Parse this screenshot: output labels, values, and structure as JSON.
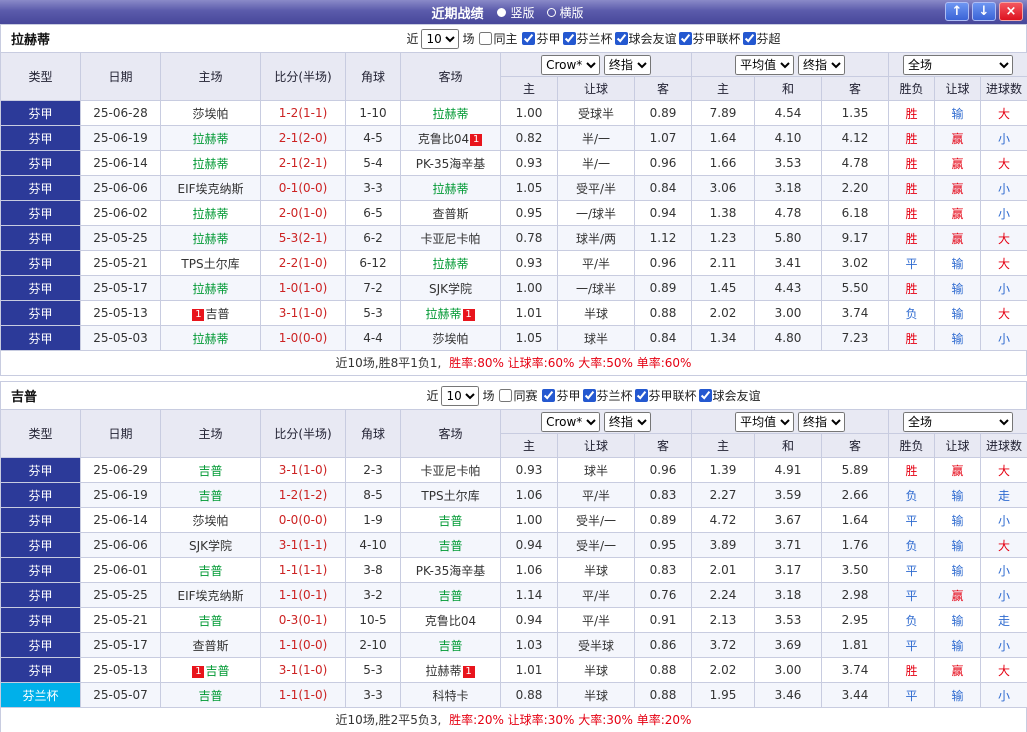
{
  "titlebar": {
    "title": "近期战绩",
    "radios": [
      {
        "label": "竖版",
        "selected": true
      },
      {
        "label": "横版",
        "selected": false
      }
    ],
    "up_icon": "↑",
    "down_icon": "↓",
    "close_icon": "×"
  },
  "filter_common": {
    "prefix": "近",
    "count": "10",
    "suffix": "场"
  },
  "table_header": {
    "main": [
      "类型",
      "日期",
      "主场",
      "比分(半场)",
      "角球",
      "客场"
    ],
    "group1": {
      "select_a": "Crow*",
      "select_b": "终指",
      "cols": [
        "主",
        "让球",
        "客"
      ]
    },
    "group2": {
      "select_a": "平均值",
      "select_b": "终指",
      "cols": [
        "主",
        "和",
        "客"
      ]
    },
    "group3": {
      "select": "全场",
      "cols": [
        "胜负",
        "让球",
        "进球数"
      ]
    }
  },
  "sections": [
    {
      "team": "拉赫蒂",
      "filter": {
        "same": "同主",
        "leagues": [
          "芬甲",
          "芬兰杯",
          "球会友谊",
          "芬甲联杯",
          "芬超"
        ]
      },
      "rows": [
        {
          "league": "芬甲",
          "leagueStyle": "navy",
          "date": "25-06-28",
          "home": {
            "name": "莎埃帕",
            "green": false
          },
          "score": "1-2(1-1)",
          "corner": "1-10",
          "away": {
            "name": "拉赫蒂",
            "green": true
          },
          "odds": [
            "1.00",
            "受球半",
            "0.89",
            "7.89",
            "4.54",
            "1.35"
          ],
          "result": {
            "text": "胜",
            "color": "red"
          },
          "handicap": {
            "text": "输",
            "color": "blue"
          },
          "goals": {
            "text": "大",
            "color": "red"
          }
        },
        {
          "league": "芬甲",
          "leagueStyle": "navy",
          "date": "25-06-19",
          "home": {
            "name": "拉赫蒂",
            "green": true
          },
          "score": "2-1(2-0)",
          "corner": "4-5",
          "away": {
            "name": "克鲁比04",
            "green": false,
            "badge_after": "1"
          },
          "odds": [
            "0.82",
            "半/一",
            "1.07",
            "1.64",
            "4.10",
            "4.12"
          ],
          "result": {
            "text": "胜",
            "color": "red"
          },
          "handicap": {
            "text": "赢",
            "color": "red"
          },
          "goals": {
            "text": "小",
            "color": "blue"
          }
        },
        {
          "league": "芬甲",
          "leagueStyle": "navy",
          "date": "25-06-14",
          "home": {
            "name": "拉赫蒂",
            "green": true
          },
          "score": "2-1(2-1)",
          "corner": "5-4",
          "away": {
            "name": "PK-35海辛基",
            "green": false
          },
          "odds": [
            "0.93",
            "半/一",
            "0.96",
            "1.66",
            "3.53",
            "4.78"
          ],
          "result": {
            "text": "胜",
            "color": "red"
          },
          "handicap": {
            "text": "赢",
            "color": "red"
          },
          "goals": {
            "text": "大",
            "color": "red"
          }
        },
        {
          "league": "芬甲",
          "leagueStyle": "navy",
          "date": "25-06-06",
          "home": {
            "name": "EIF埃克纳斯",
            "green": false
          },
          "score": "0-1(0-0)",
          "corner": "3-3",
          "away": {
            "name": "拉赫蒂",
            "green": true
          },
          "odds": [
            "1.05",
            "受平/半",
            "0.84",
            "3.06",
            "3.18",
            "2.20"
          ],
          "result": {
            "text": "胜",
            "color": "red"
          },
          "handicap": {
            "text": "赢",
            "color": "red"
          },
          "goals": {
            "text": "小",
            "color": "blue"
          }
        },
        {
          "league": "芬甲",
          "leagueStyle": "navy",
          "date": "25-06-02",
          "home": {
            "name": "拉赫蒂",
            "green": true
          },
          "score": "2-0(1-0)",
          "corner": "6-5",
          "away": {
            "name": "查普斯",
            "green": false
          },
          "odds": [
            "0.95",
            "一/球半",
            "0.94",
            "1.38",
            "4.78",
            "6.18"
          ],
          "result": {
            "text": "胜",
            "color": "red"
          },
          "handicap": {
            "text": "赢",
            "color": "red"
          },
          "goals": {
            "text": "小",
            "color": "blue"
          }
        },
        {
          "league": "芬甲",
          "leagueStyle": "navy",
          "date": "25-05-25",
          "home": {
            "name": "拉赫蒂",
            "green": true
          },
          "score": "5-3(2-1)",
          "corner": "6-2",
          "away": {
            "name": "卡亚尼卡帕",
            "green": false
          },
          "odds": [
            "0.78",
            "球半/两",
            "1.12",
            "1.23",
            "5.80",
            "9.17"
          ],
          "result": {
            "text": "胜",
            "color": "red"
          },
          "handicap": {
            "text": "赢",
            "color": "red"
          },
          "goals": {
            "text": "大",
            "color": "red"
          }
        },
        {
          "league": "芬甲",
          "leagueStyle": "navy",
          "date": "25-05-21",
          "home": {
            "name": "TPS土尔库",
            "green": false
          },
          "score": "2-2(1-0)",
          "corner": "6-12",
          "away": {
            "name": "拉赫蒂",
            "green": true
          },
          "odds": [
            "0.93",
            "平/半",
            "0.96",
            "2.11",
            "3.41",
            "3.02"
          ],
          "result": {
            "text": "平",
            "color": "blue"
          },
          "handicap": {
            "text": "输",
            "color": "blue"
          },
          "goals": {
            "text": "大",
            "color": "red"
          }
        },
        {
          "league": "芬甲",
          "leagueStyle": "navy",
          "date": "25-05-17",
          "home": {
            "name": "拉赫蒂",
            "green": true
          },
          "score": "1-0(1-0)",
          "corner": "7-2",
          "away": {
            "name": "SJK学院",
            "green": false
          },
          "odds": [
            "1.00",
            "一/球半",
            "0.89",
            "1.45",
            "4.43",
            "5.50"
          ],
          "result": {
            "text": "胜",
            "color": "red"
          },
          "handicap": {
            "text": "输",
            "color": "blue"
          },
          "goals": {
            "text": "小",
            "color": "blue"
          }
        },
        {
          "league": "芬甲",
          "leagueStyle": "navy",
          "date": "25-05-13",
          "home": {
            "name": "吉普",
            "green": false,
            "badge_before": "1"
          },
          "score": "3-1(1-0)",
          "corner": "5-3",
          "away": {
            "name": "拉赫蒂",
            "green": true,
            "badge_after": "1"
          },
          "odds": [
            "1.01",
            "半球",
            "0.88",
            "2.02",
            "3.00",
            "3.74"
          ],
          "result": {
            "text": "负",
            "color": "blue"
          },
          "handicap": {
            "text": "输",
            "color": "blue"
          },
          "goals": {
            "text": "大",
            "color": "red"
          }
        },
        {
          "league": "芬甲",
          "leagueStyle": "navy",
          "date": "25-05-03",
          "home": {
            "name": "拉赫蒂",
            "green": true
          },
          "score": "1-0(0-0)",
          "corner": "4-4",
          "away": {
            "name": "莎埃帕",
            "green": false
          },
          "odds": [
            "1.05",
            "球半",
            "0.84",
            "1.34",
            "4.80",
            "7.23"
          ],
          "result": {
            "text": "胜",
            "color": "red"
          },
          "handicap": {
            "text": "输",
            "color": "blue"
          },
          "goals": {
            "text": "小",
            "color": "blue"
          }
        }
      ],
      "summary": {
        "prefix": "近10场,胜8平1负1,",
        "stats": "胜率:80% 让球率:60% 大率:50% 单率:60%"
      }
    },
    {
      "team": "吉普",
      "filter": {
        "same": "同赛",
        "leagues": [
          "芬甲",
          "芬兰杯",
          "芬甲联杯",
          "球会友谊"
        ]
      },
      "rows": [
        {
          "league": "芬甲",
          "leagueStyle": "navy",
          "date": "25-06-29",
          "home": {
            "name": "吉普",
            "green": true
          },
          "score": "3-1(1-0)",
          "corner": "2-3",
          "away": {
            "name": "卡亚尼卡帕",
            "green": false
          },
          "odds": [
            "0.93",
            "球半",
            "0.96",
            "1.39",
            "4.91",
            "5.89"
          ],
          "result": {
            "text": "胜",
            "color": "red"
          },
          "handicap": {
            "text": "赢",
            "color": "red"
          },
          "goals": {
            "text": "大",
            "color": "red"
          }
        },
        {
          "league": "芬甲",
          "leagueStyle": "navy",
          "date": "25-06-19",
          "home": {
            "name": "吉普",
            "green": true
          },
          "score": "1-2(1-2)",
          "corner": "8-5",
          "away": {
            "name": "TPS土尔库",
            "green": false
          },
          "odds": [
            "1.06",
            "平/半",
            "0.83",
            "2.27",
            "3.59",
            "2.66"
          ],
          "result": {
            "text": "负",
            "color": "blue"
          },
          "handicap": {
            "text": "输",
            "color": "blue"
          },
          "goals": {
            "text": "走",
            "color": "blue"
          }
        },
        {
          "league": "芬甲",
          "leagueStyle": "navy",
          "date": "25-06-14",
          "home": {
            "name": "莎埃帕",
            "green": false
          },
          "score": "0-0(0-0)",
          "corner": "1-9",
          "away": {
            "name": "吉普",
            "green": true
          },
          "odds": [
            "1.00",
            "受半/一",
            "0.89",
            "4.72",
            "3.67",
            "1.64"
          ],
          "result": {
            "text": "平",
            "color": "blue"
          },
          "handicap": {
            "text": "输",
            "color": "blue"
          },
          "goals": {
            "text": "小",
            "color": "blue"
          }
        },
        {
          "league": "芬甲",
          "leagueStyle": "navy",
          "date": "25-06-06",
          "home": {
            "name": "SJK学院",
            "green": false
          },
          "score": "3-1(1-1)",
          "corner": "4-10",
          "away": {
            "name": "吉普",
            "green": true
          },
          "odds": [
            "0.94",
            "受半/一",
            "0.95",
            "3.89",
            "3.71",
            "1.76"
          ],
          "result": {
            "text": "负",
            "color": "blue"
          },
          "handicap": {
            "text": "输",
            "color": "blue"
          },
          "goals": {
            "text": "大",
            "color": "red"
          }
        },
        {
          "league": "芬甲",
          "leagueStyle": "navy",
          "date": "25-06-01",
          "home": {
            "name": "吉普",
            "green": true
          },
          "score": "1-1(1-1)",
          "corner": "3-8",
          "away": {
            "name": "PK-35海辛基",
            "green": false
          },
          "odds": [
            "1.06",
            "半球",
            "0.83",
            "2.01",
            "3.17",
            "3.50"
          ],
          "result": {
            "text": "平",
            "color": "blue"
          },
          "handicap": {
            "text": "输",
            "color": "blue"
          },
          "goals": {
            "text": "小",
            "color": "blue"
          }
        },
        {
          "league": "芬甲",
          "leagueStyle": "navy",
          "date": "25-05-25",
          "home": {
            "name": "EIF埃克纳斯",
            "green": false
          },
          "score": "1-1(0-1)",
          "corner": "3-2",
          "away": {
            "name": "吉普",
            "green": true
          },
          "odds": [
            "1.14",
            "平/半",
            "0.76",
            "2.24",
            "3.18",
            "2.98"
          ],
          "result": {
            "text": "平",
            "color": "blue"
          },
          "handicap": {
            "text": "赢",
            "color": "red"
          },
          "goals": {
            "text": "小",
            "color": "blue"
          }
        },
        {
          "league": "芬甲",
          "leagueStyle": "navy",
          "date": "25-05-21",
          "home": {
            "name": "吉普",
            "green": true
          },
          "score": "0-3(0-1)",
          "corner": "10-5",
          "away": {
            "name": "克鲁比04",
            "green": false
          },
          "odds": [
            "0.94",
            "平/半",
            "0.91",
            "2.13",
            "3.53",
            "2.95"
          ],
          "result": {
            "text": "负",
            "color": "blue"
          },
          "handicap": {
            "text": "输",
            "color": "blue"
          },
          "goals": {
            "text": "走",
            "color": "blue"
          }
        },
        {
          "league": "芬甲",
          "leagueStyle": "navy",
          "date": "25-05-17",
          "home": {
            "name": "查普斯",
            "green": false
          },
          "score": "1-1(0-0)",
          "corner": "2-10",
          "away": {
            "name": "吉普",
            "green": true
          },
          "odds": [
            "1.03",
            "受半球",
            "0.86",
            "3.72",
            "3.69",
            "1.81"
          ],
          "result": {
            "text": "平",
            "color": "blue"
          },
          "handicap": {
            "text": "输",
            "color": "blue"
          },
          "goals": {
            "text": "小",
            "color": "blue"
          }
        },
        {
          "league": "芬甲",
          "leagueStyle": "navy",
          "date": "25-05-13",
          "home": {
            "name": "吉普",
            "green": true,
            "badge_before": "1"
          },
          "score": "3-1(1-0)",
          "corner": "5-3",
          "away": {
            "name": "拉赫蒂",
            "green": false,
            "badge_after": "1"
          },
          "odds": [
            "1.01",
            "半球",
            "0.88",
            "2.02",
            "3.00",
            "3.74"
          ],
          "result": {
            "text": "胜",
            "color": "red"
          },
          "handicap": {
            "text": "赢",
            "color": "red"
          },
          "goals": {
            "text": "大",
            "color": "red"
          }
        },
        {
          "league": "芬兰杯",
          "leagueStyle": "cyan",
          "date": "25-05-07",
          "home": {
            "name": "吉普",
            "green": true
          },
          "score": "1-1(1-0)",
          "corner": "3-3",
          "away": {
            "name": "科特卡",
            "green": false
          },
          "odds": [
            "0.88",
            "半球",
            "0.88",
            "1.95",
            "3.46",
            "3.44"
          ],
          "result": {
            "text": "平",
            "color": "blue"
          },
          "handicap": {
            "text": "输",
            "color": "blue"
          },
          "goals": {
            "text": "小",
            "color": "blue"
          }
        }
      ],
      "summary": {
        "prefix": "近10场,胜2平5负3,",
        "stats": "胜率:20% 让球率:30% 大率:30% 单率:20%"
      }
    }
  ]
}
